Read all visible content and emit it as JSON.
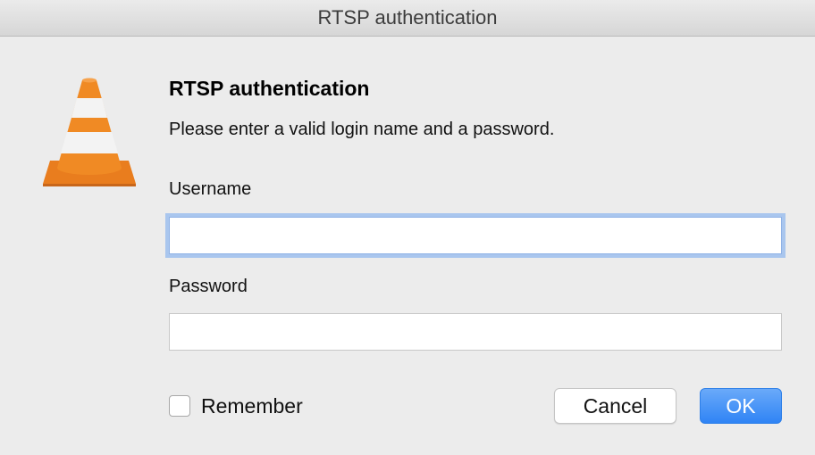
{
  "window": {
    "title": "RTSP authentication"
  },
  "dialog": {
    "icon": "vlc-cone-icon",
    "heading": "RTSP authentication",
    "message": "Please enter a valid login name and a password.",
    "username_label": "Username",
    "username_value": "",
    "password_label": "Password",
    "password_value": "",
    "remember_label": "Remember",
    "remember_checked": false,
    "cancel_label": "Cancel",
    "ok_label": "OK"
  },
  "colors": {
    "cone_orange": "#f08a24",
    "cone_white": "#f3f3f3",
    "focus_ring": "#a9c6ee",
    "ok_button": "#3a8cf6"
  }
}
